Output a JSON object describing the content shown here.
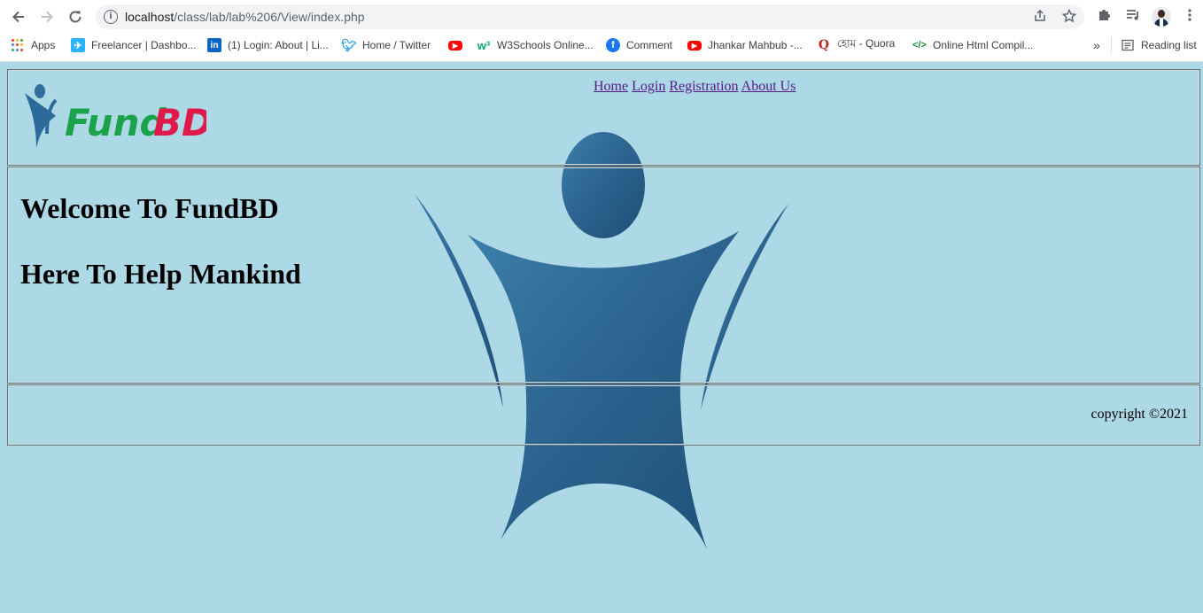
{
  "browser": {
    "url_host": "localhost",
    "url_path": "/class/lab/lab%206/View/index.php",
    "bookmarks": [
      {
        "label": "Apps",
        "icon": "apps-icon"
      },
      {
        "label": "Freelancer | Dashbo...",
        "icon": "freelancer-icon"
      },
      {
        "label": "(1) Login: About | Li...",
        "icon": "linkedin-icon"
      },
      {
        "label": "Home / Twitter",
        "icon": "twitter-icon"
      },
      {
        "label": "",
        "icon": "youtube-icon"
      },
      {
        "label": "W3Schools Online...",
        "icon": "w3schools-icon"
      },
      {
        "label": "Comment",
        "icon": "facebook-icon"
      },
      {
        "label": "Jhankar Mahbub -...",
        "icon": "youtube-icon"
      },
      {
        "label": "হোম - Quora",
        "icon": "quora-icon"
      },
      {
        "label": "Online Html Compil...",
        "icon": "code-icon"
      }
    ],
    "overflow": "»",
    "reading_list": "Reading list"
  },
  "site": {
    "logo_text_fund": "Fund",
    "logo_text_bd": "BD",
    "nav": [
      "Home",
      "Login",
      "Registration",
      "About Us"
    ],
    "welcome": "Welcome To FundBD",
    "tagline": "Here To Help Mankind",
    "copyright": "copyright ©2021"
  },
  "colors": {
    "page_bg": "#add8e6",
    "link": "#551a8b",
    "figure": "#2e6a96",
    "logo_green": "#1aa34a",
    "logo_red": "#e0194b"
  }
}
